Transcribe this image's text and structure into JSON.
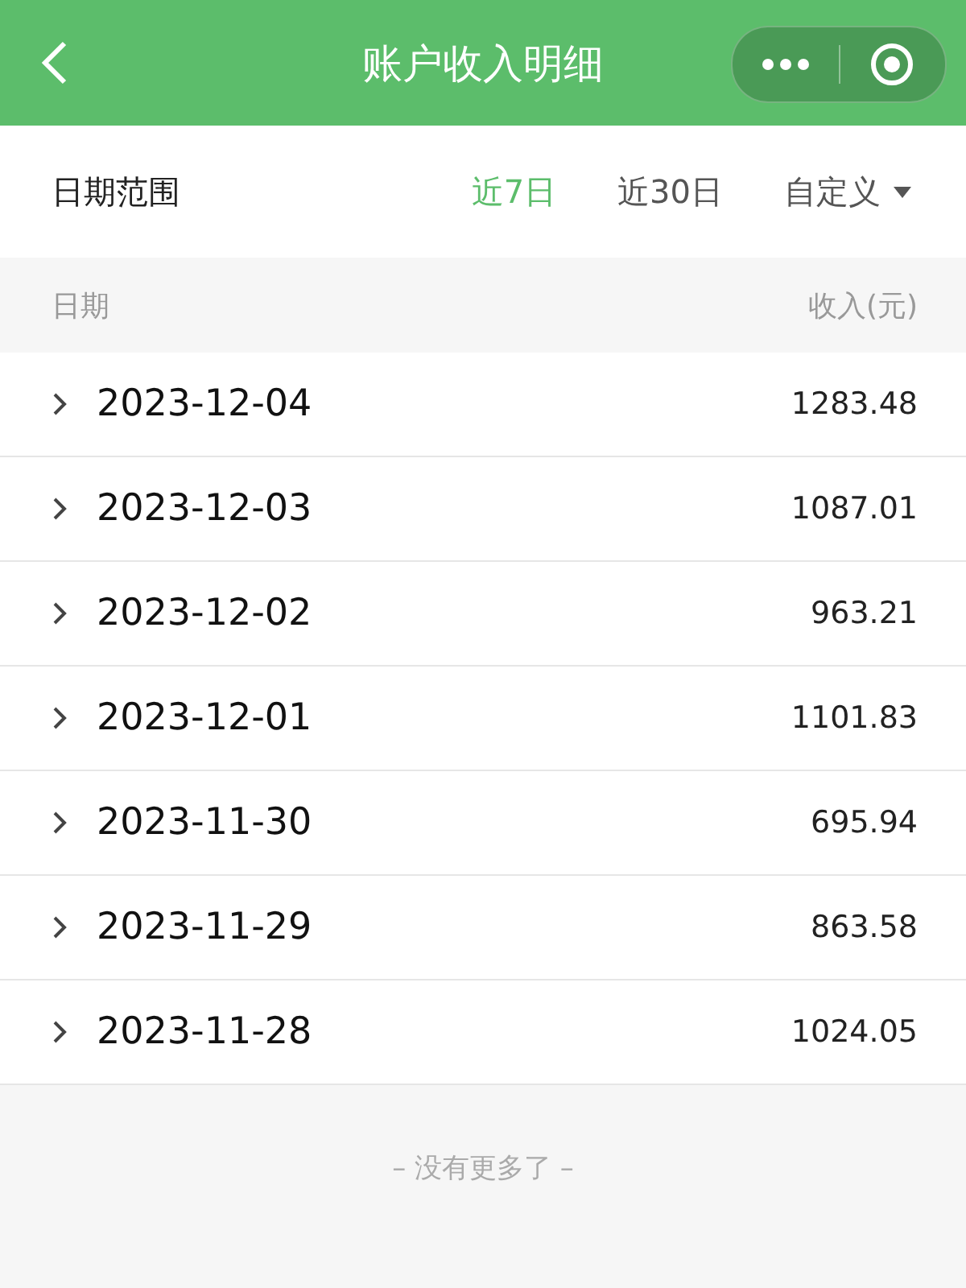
{
  "header": {
    "title": "账户收入明细"
  },
  "filter": {
    "label": "日期范围",
    "options": [
      {
        "label": "近7日",
        "selected": true,
        "kind": "plain"
      },
      {
        "label": "近30日",
        "selected": false,
        "kind": "plain"
      },
      {
        "label": "自定义",
        "selected": false,
        "kind": "dropdown"
      }
    ]
  },
  "table": {
    "columns": [
      "日期",
      "收入(元)"
    ],
    "rows": [
      {
        "date": "2023-12-04",
        "amount": "1283.48"
      },
      {
        "date": "2023-12-03",
        "amount": "1087.01"
      },
      {
        "date": "2023-12-02",
        "amount": "963.21"
      },
      {
        "date": "2023-12-01",
        "amount": "1101.83"
      },
      {
        "date": "2023-11-30",
        "amount": "695.94"
      },
      {
        "date": "2023-11-29",
        "amount": "863.58"
      },
      {
        "date": "2023-11-28",
        "amount": "1024.05"
      }
    ]
  },
  "footer": "– 没有更多了 –"
}
